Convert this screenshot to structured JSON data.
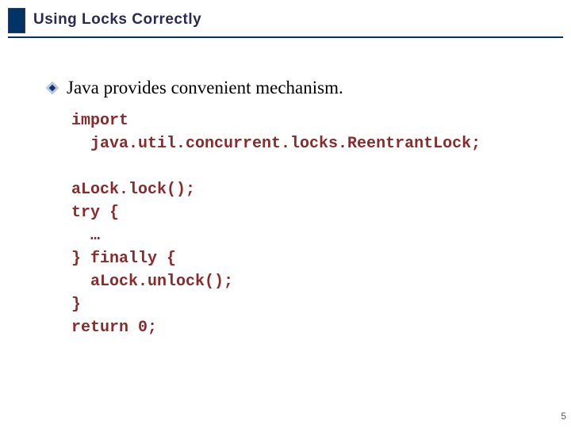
{
  "title": "Using Locks Correctly",
  "bullet": "Java provides convenient mechanism.",
  "code": "import\n  java.util.concurrent.locks.ReentrantLock;\n\naLock.lock();\ntry {\n  …\n} finally {\n  aLock.unlock();\n}\nreturn 0;",
  "page_number": "5"
}
